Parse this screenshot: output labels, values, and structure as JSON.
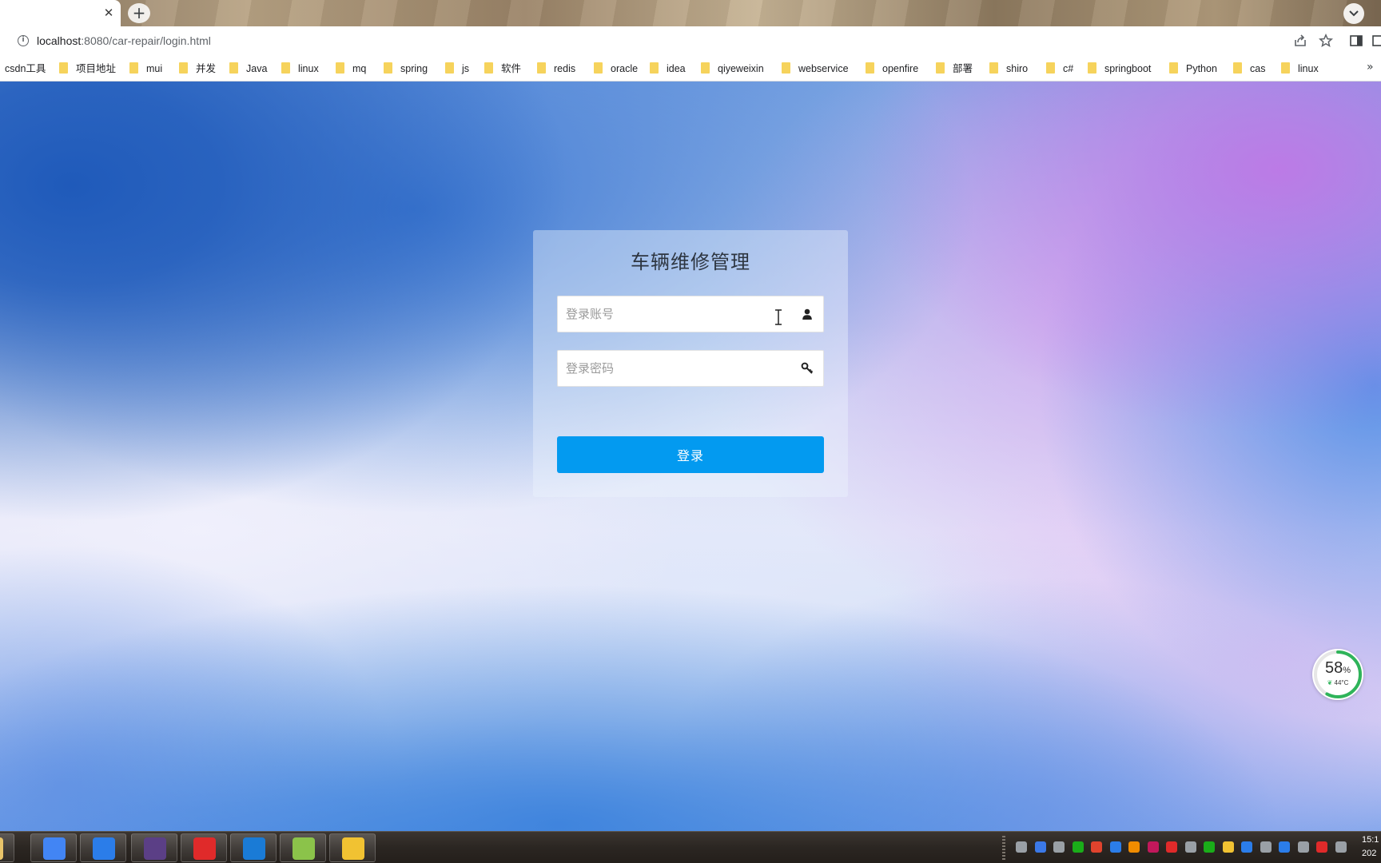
{
  "browser": {
    "url_host": "localhost",
    "url_path": ":8080/car-repair/login.html",
    "bookmarks": [
      {
        "label": "csdn工具",
        "folder": false
      },
      {
        "label": "项目地址",
        "folder": true
      },
      {
        "label": "mui",
        "folder": true
      },
      {
        "label": "并发",
        "folder": true
      },
      {
        "label": "Java",
        "folder": true
      },
      {
        "label": "linux",
        "folder": true
      },
      {
        "label": "mq",
        "folder": true
      },
      {
        "label": "spring",
        "folder": true
      },
      {
        "label": "js",
        "folder": true
      },
      {
        "label": "软件",
        "folder": true
      },
      {
        "label": "redis",
        "folder": true
      },
      {
        "label": "oracle",
        "folder": true
      },
      {
        "label": "idea",
        "folder": true
      },
      {
        "label": "qiyeweixin",
        "folder": true
      },
      {
        "label": "webservice",
        "folder": true
      },
      {
        "label": "openfire",
        "folder": true
      },
      {
        "label": "部署",
        "folder": true
      },
      {
        "label": "shiro",
        "folder": true
      },
      {
        "label": "c#",
        "folder": true
      },
      {
        "label": "springboot",
        "folder": true
      },
      {
        "label": "Python",
        "folder": true
      },
      {
        "label": "cas",
        "folder": true
      },
      {
        "label": "linux",
        "folder": true
      }
    ],
    "more_bookmarks": "»"
  },
  "login": {
    "title": "车辆维修管理",
    "username_placeholder": "登录账号",
    "password_placeholder": "登录密码",
    "submit_label": "登录"
  },
  "battery_widget": {
    "percent": "58",
    "percent_unit": "%",
    "temperature": "44°C",
    "level": 0.58,
    "ring_color": "#2fb45a"
  },
  "taskbar": {
    "apps": [
      {
        "icon": "file-explorer-icon",
        "color": "#e8c46a"
      },
      {
        "icon": "chrome-icon",
        "color": "#4285f4"
      },
      {
        "icon": "feishu-icon",
        "color": "#2b7de9"
      },
      {
        "icon": "java-ee-ide-icon",
        "color": "#5b3f86"
      },
      {
        "icon": "netease-music-icon",
        "color": "#e02a2a"
      },
      {
        "icon": "app-blue-icon",
        "color": "#1a7bd6"
      },
      {
        "icon": "notepad-plus-plus-icon",
        "color": "#8bc34a"
      },
      {
        "icon": "cloud-app-icon",
        "color": "#f1c232"
      }
    ],
    "clock_time": "15:1",
    "clock_date": "202"
  },
  "colors": {
    "accent_button": "#039af0",
    "title_text": "#2d3540"
  }
}
